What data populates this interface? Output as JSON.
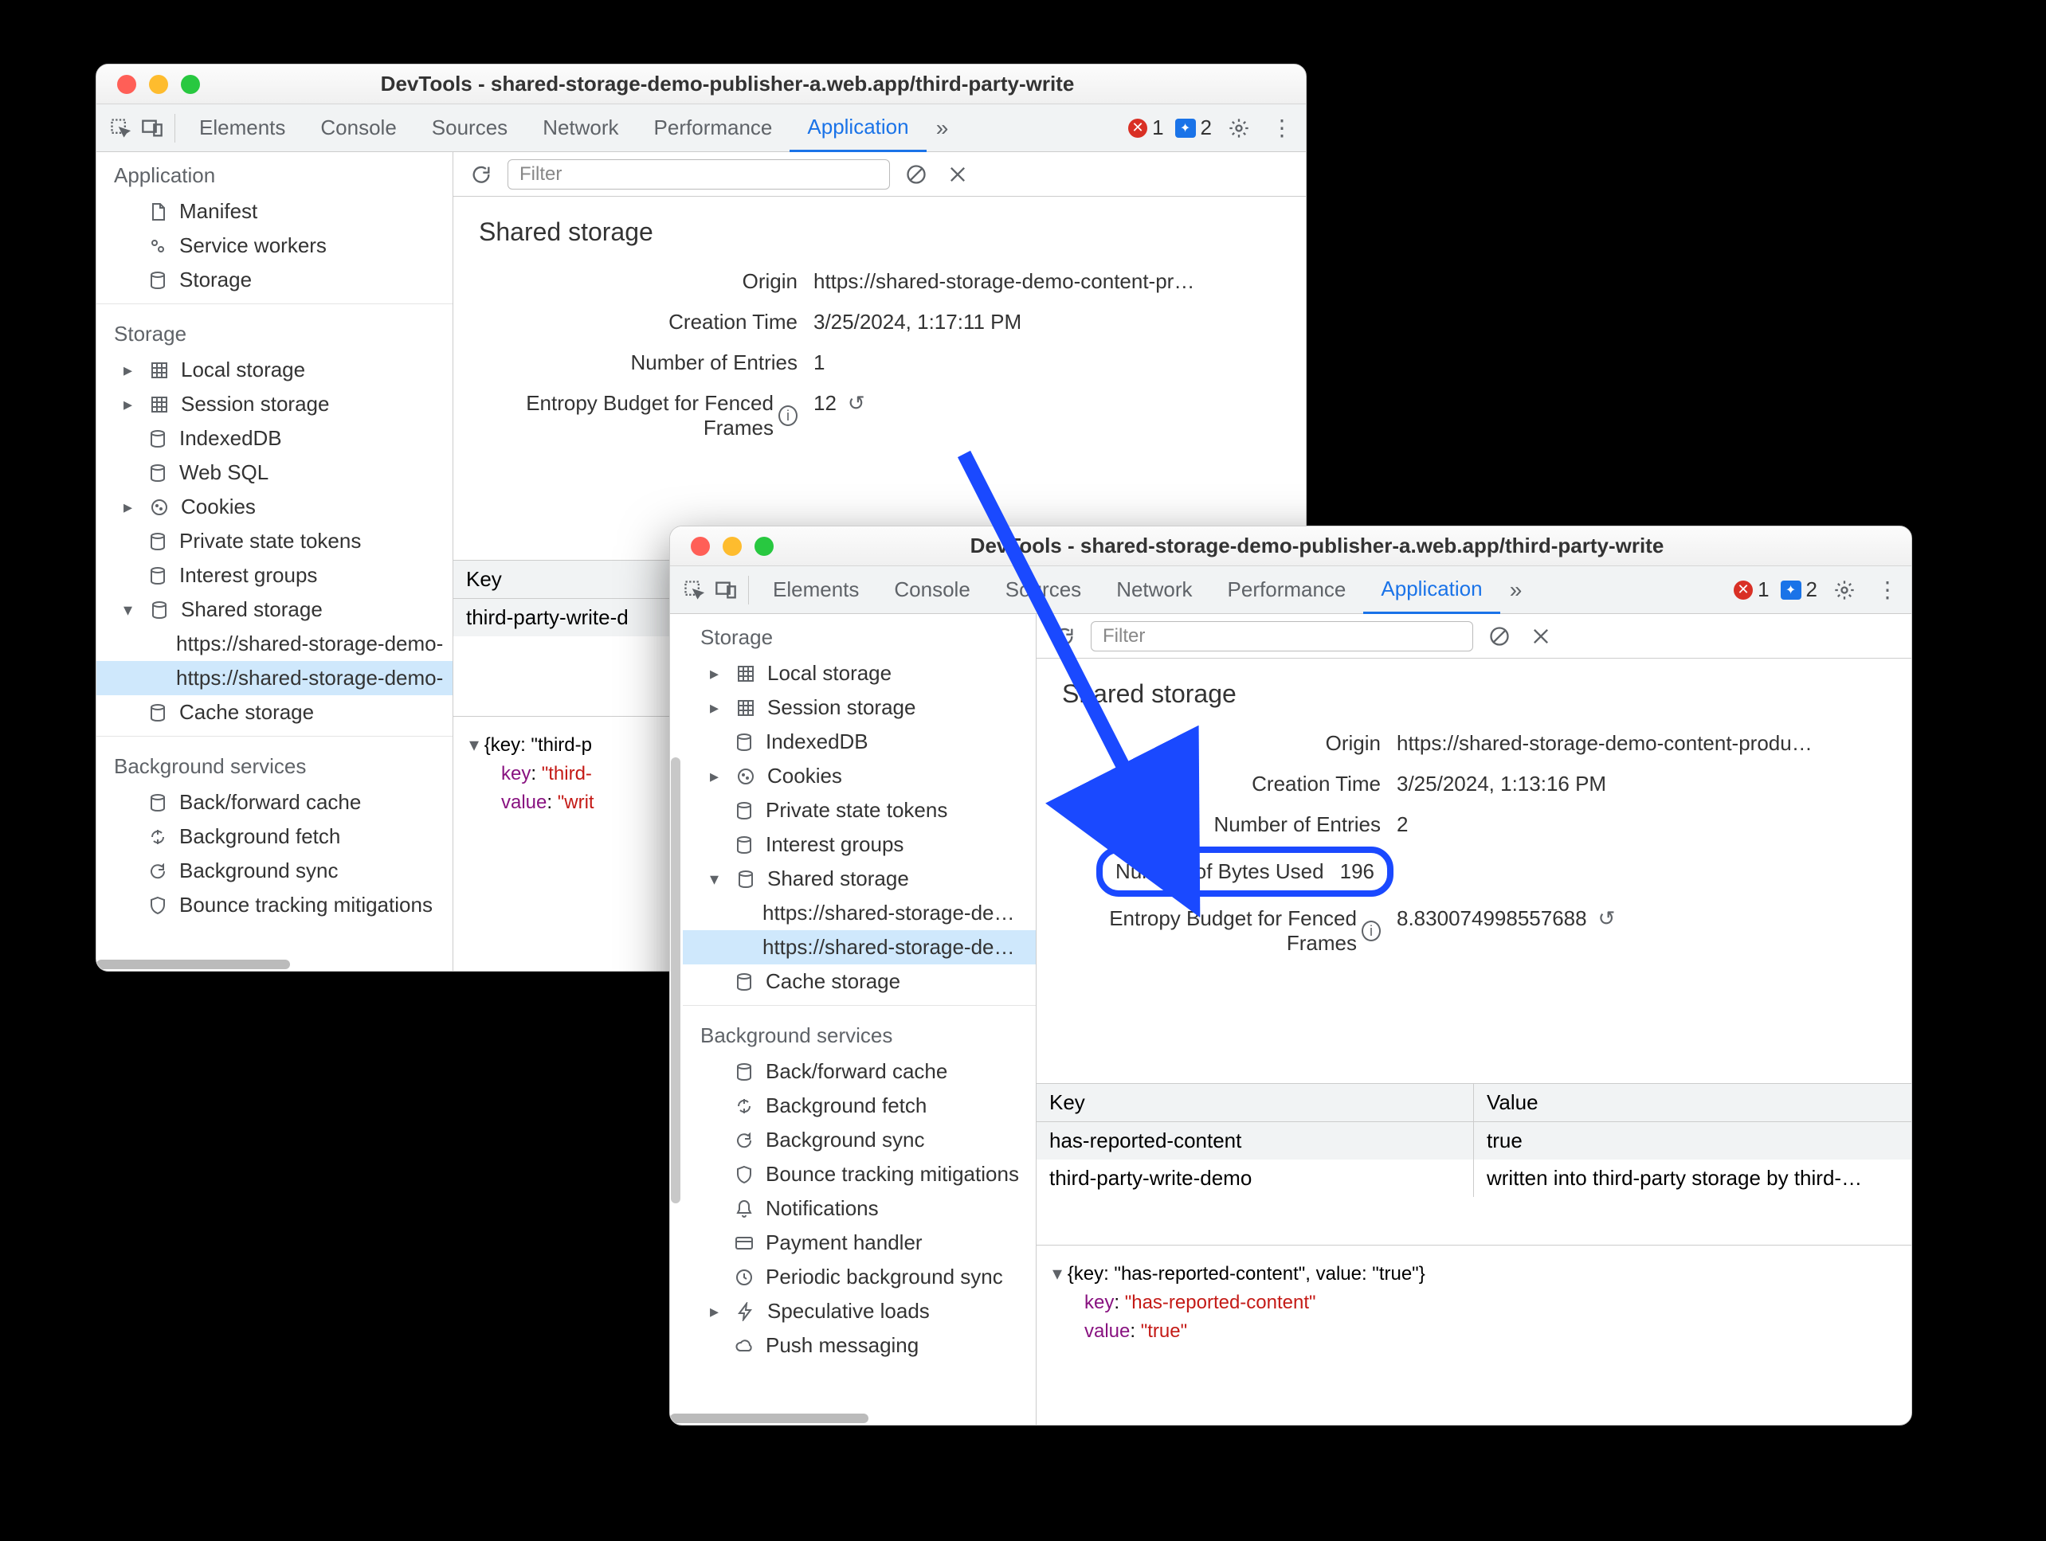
{
  "windowA": {
    "title": "DevTools - shared-storage-demo-publisher-a.web.app/third-party-write",
    "tabs": [
      "Elements",
      "Console",
      "Sources",
      "Network",
      "Performance",
      "Application"
    ],
    "active_tab": "Application",
    "err_count": "1",
    "msg_count": "2",
    "filter_placeholder": "Filter",
    "sidebar": {
      "sec_application": "Application",
      "manifest": "Manifest",
      "service_workers": "Service workers",
      "storage": "Storage",
      "sec_storage": "Storage",
      "local_storage": "Local storage",
      "session_storage": "Session storage",
      "indexeddb": "IndexedDB",
      "web_sql": "Web SQL",
      "cookies": "Cookies",
      "private_state_tokens": "Private state tokens",
      "interest_groups": "Interest groups",
      "shared_storage": "Shared storage",
      "shared_leaf_a": "https://shared-storage-demo-",
      "shared_leaf_b": "https://shared-storage-demo-",
      "cache_storage": "Cache storage",
      "sec_bg": "Background services",
      "bf_cache": "Back/forward cache",
      "bg_fetch": "Background fetch",
      "bg_sync": "Background sync",
      "bounce_tracking": "Bounce tracking mitigations"
    },
    "shared": {
      "title": "Shared storage",
      "origin_k": "Origin",
      "origin_v": "https://shared-storage-demo-content-pr…",
      "ctime_k": "Creation Time",
      "ctime_v": "3/25/2024, 1:17:11 PM",
      "entries_k": "Number of Entries",
      "entries_v": "1",
      "entropy_k": "Entropy Budget for Fenced Frames",
      "entropy_v": "12"
    },
    "table": {
      "key_hd": "Key",
      "key_row": "third-party-write-d"
    },
    "obj": {
      "line1": "{key: \"third-p",
      "key_label": "key",
      "key_val": "\"third-",
      "val_label": "value",
      "val_val": "\"writ"
    }
  },
  "windowB": {
    "title": "DevTools - shared-storage-demo-publisher-a.web.app/third-party-write",
    "tabs": [
      "Elements",
      "Console",
      "Sources",
      "Network",
      "Performance",
      "Application"
    ],
    "active_tab": "Application",
    "err_count": "1",
    "msg_count": "2",
    "filter_placeholder": "Filter",
    "sidebar": {
      "sec_storage": "Storage",
      "local_storage": "Local storage",
      "session_storage": "Session storage",
      "indexeddb": "IndexedDB",
      "cookies": "Cookies",
      "private_state_tokens": "Private state tokens",
      "interest_groups": "Interest groups",
      "shared_storage": "Shared storage",
      "shared_leaf_a": "https://shared-storage-demo-",
      "shared_leaf_b": "https://shared-storage-demo-",
      "cache_storage": "Cache storage",
      "sec_bg": "Background services",
      "bf_cache": "Back/forward cache",
      "bg_fetch": "Background fetch",
      "bg_sync": "Background sync",
      "bounce_tracking": "Bounce tracking mitigations",
      "notifications": "Notifications",
      "payment_handler": "Payment handler",
      "periodic_bg_sync": "Periodic background sync",
      "speculative_loads": "Speculative loads",
      "push_messaging": "Push messaging"
    },
    "shared": {
      "title": "Shared storage",
      "origin_k": "Origin",
      "origin_v": "https://shared-storage-demo-content-produ…",
      "ctime_k": "Creation Time",
      "ctime_v": "3/25/2024, 1:13:16 PM",
      "entries_k": "Number of Entries",
      "entries_v": "2",
      "bytes_k": "Number of Bytes Used",
      "bytes_v": "196",
      "entropy_k": "Entropy Budget for Fenced Frames",
      "entropy_v": "8.830074998557688"
    },
    "table": {
      "key_hd": "Key",
      "val_hd": "Value",
      "rows": [
        {
          "k": "has-reported-content",
          "v": "true"
        },
        {
          "k": "third-party-write-demo",
          "v": "written into third-party storage by third-…"
        }
      ]
    },
    "obj": {
      "line1": "{key: \"has-reported-content\", value: \"true\"}",
      "key_label": "key",
      "key_val": "\"has-reported-content\"",
      "val_label": "value",
      "val_val": "\"true\""
    }
  }
}
